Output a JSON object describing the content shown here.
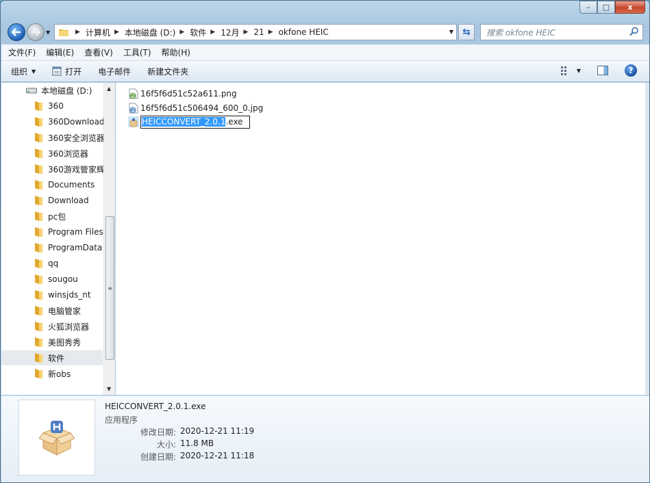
{
  "window": {
    "caption": {
      "minimize": "–",
      "maximize": "□",
      "close": "x"
    }
  },
  "address": {
    "crumbs": [
      "计算机",
      "本地磁盘 (D:)",
      "软件",
      "12月",
      "21",
      "okfone HEIC"
    ],
    "search_placeholder": "搜索 okfone HEIC"
  },
  "menu": [
    "文件(F)",
    "编辑(E)",
    "查看(V)",
    "工具(T)",
    "帮助(H)"
  ],
  "commands": {
    "organize": "组织",
    "open": "打开",
    "email": "电子邮件",
    "new_folder": "新建文件夹"
  },
  "tree": {
    "drive": "本地磁盘 (D:)",
    "folders": [
      "360",
      "360Download",
      "360安全浏览器",
      "360浏览器",
      "360游戏管家辉",
      "Documents",
      "Download",
      "pc包",
      "Program Files",
      "ProgramData",
      "qq",
      "sougou",
      "winsjds_nt",
      "电脑管家",
      "火狐浏览器",
      "美图秀秀",
      "软件",
      "新obs"
    ],
    "selected": "软件"
  },
  "files": [
    {
      "name": "16f5f6d51c52a611.png",
      "icon": "png-file-icon"
    },
    {
      "name": "16f5f6d51c506494_600_0.jpg",
      "icon": "jpg-file-icon"
    }
  ],
  "renaming": {
    "selected_part": "HEICCONVERT_2.0.1",
    "extension": ".exe",
    "icon": "installer-icon"
  },
  "details": {
    "name": "HEICCONVERT_2.0.1.exe",
    "type": "应用程序",
    "modified_label": "修改日期:",
    "modified": "2020-12-21 11:19",
    "size_label": "大小:",
    "size": "11.8 MB",
    "created_label": "创建日期:",
    "created": "2020-12-21 11:18"
  },
  "colors": {
    "accent": "#3399ff",
    "selection": "#e6eaef"
  }
}
